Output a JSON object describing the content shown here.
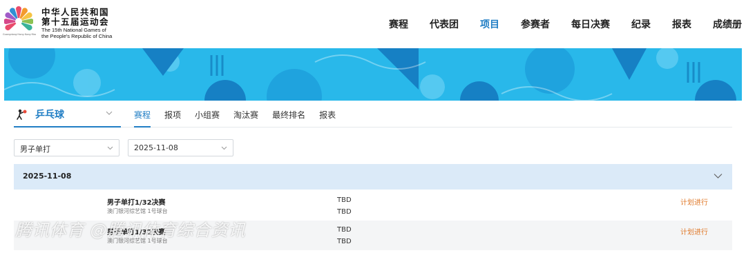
{
  "header": {
    "brand_cn_line1": "中华人民共和国",
    "brand_cn_line2": "第十五届运动会",
    "brand_en_line1": "The 15th National Games of",
    "brand_en_line2": "the People's Republic of China",
    "logo_subtitle": "Guangdong·Hong Kong·Macao",
    "nav": [
      "赛程",
      "代表团",
      "项目",
      "参赛者",
      "每日决赛",
      "纪录",
      "报表",
      "成绩册"
    ],
    "nav_active": "项目"
  },
  "sport": {
    "name": "乒乓球",
    "icon": "table-tennis-icon",
    "tabs": [
      "赛程",
      "报项",
      "小组赛",
      "淘汰赛",
      "最终排名",
      "报表"
    ],
    "active_tab": "赛程"
  },
  "filters": {
    "event": "男子单打",
    "date": "2025-11-08"
  },
  "schedule": {
    "date": "2025-11-08",
    "matches": [
      {
        "title": "男子单打1/32决赛",
        "venue": "澳门银河综艺馆 1号球台",
        "team1": "TBD",
        "team2": "TBD",
        "status": "计划进行"
      },
      {
        "title": "男子单打1/32决赛",
        "venue": "澳门银河综艺馆 1号球台",
        "team1": "TBD",
        "team2": "TBD",
        "status": "计划进行"
      }
    ]
  },
  "watermark": "腾讯体育 @腾讯体育综合资讯",
  "colors": {
    "accent": "#1f7dc4",
    "banner": "#29b8ea",
    "status": "#e07a2b",
    "date_row": "#dbeaf8"
  }
}
